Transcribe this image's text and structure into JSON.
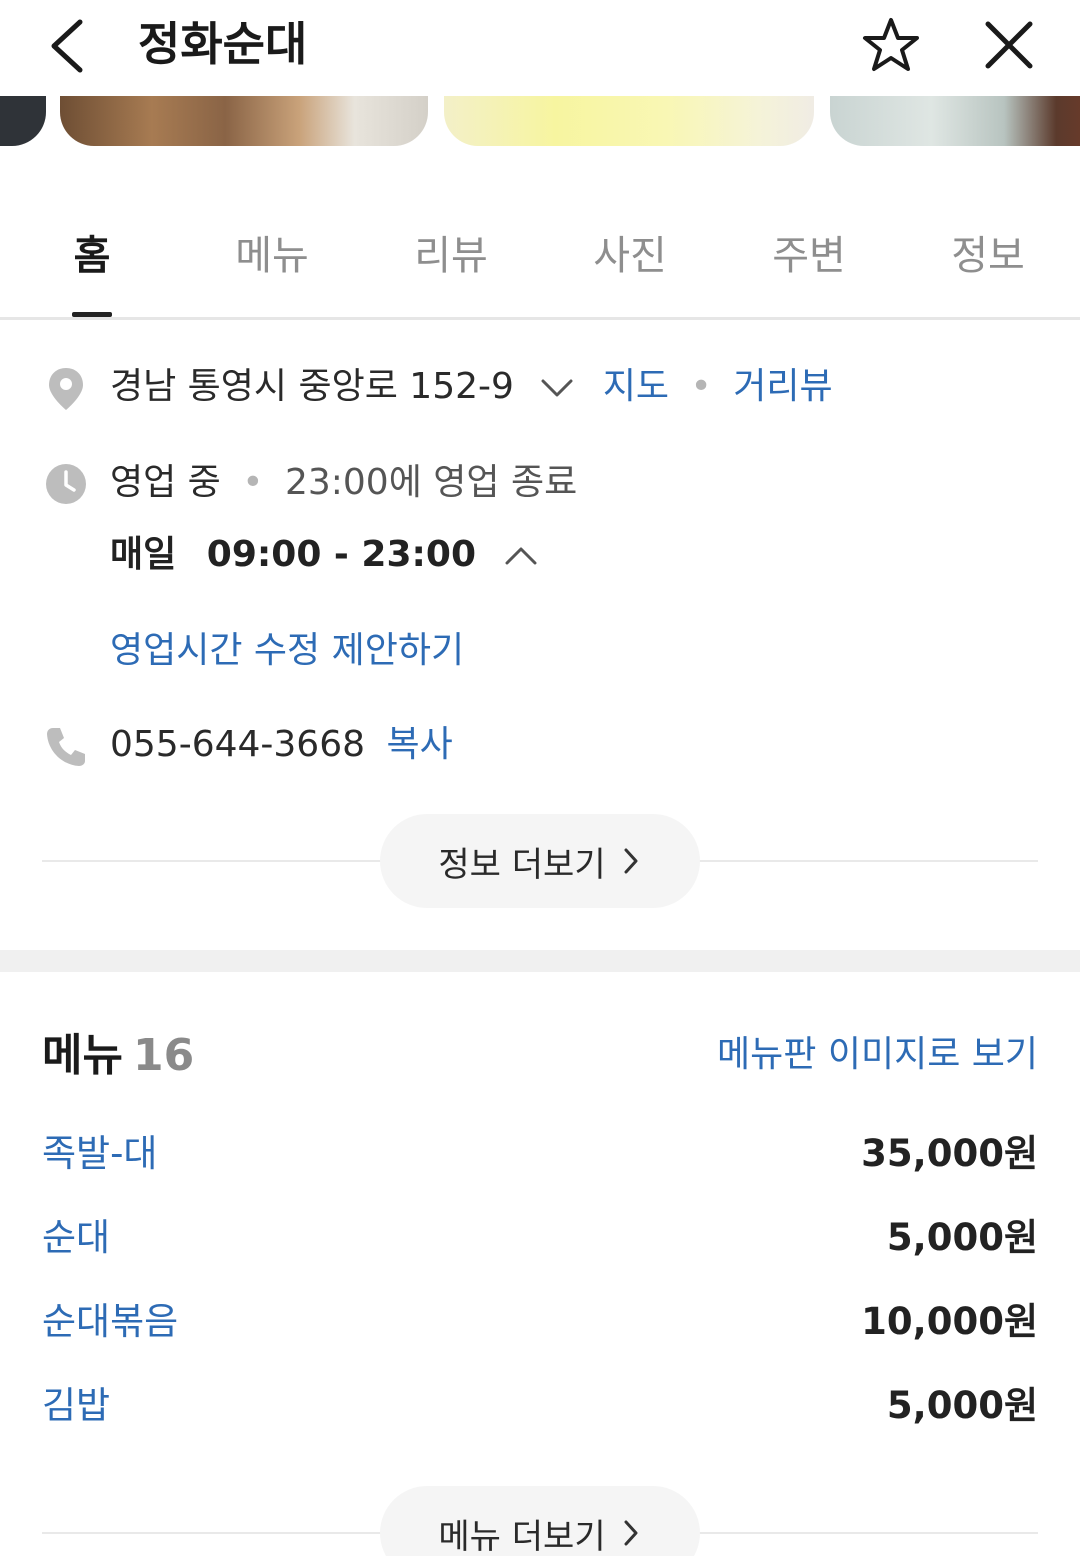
{
  "header": {
    "title": "정화순대"
  },
  "tabs": [
    {
      "label": "홈",
      "active": true
    },
    {
      "label": "메뉴",
      "active": false
    },
    {
      "label": "리뷰",
      "active": false
    },
    {
      "label": "사진",
      "active": false
    },
    {
      "label": "주변",
      "active": false
    },
    {
      "label": "정보",
      "active": false
    }
  ],
  "info": {
    "address": "경남 통영시 중앙로 152-9",
    "map_link": "지도",
    "streetview_link": "거리뷰",
    "status": "영업 중",
    "close_time": "23:00에 영업 종료",
    "hours_day": "매일",
    "hours_range": "09:00 - 23:00",
    "suggest_hours": "영업시간 수정 제안하기",
    "phone": "055-644-3668",
    "copy_label": "복사",
    "more_info": "정보 더보기"
  },
  "menu": {
    "title": "메뉴",
    "count": "16",
    "view_image": "메뉴판 이미지로 보기",
    "items": [
      {
        "name": "족발-대",
        "price": "35,000원"
      },
      {
        "name": "순대",
        "price": "5,000원"
      },
      {
        "name": "순대볶음",
        "price": "10,000원"
      },
      {
        "name": "김밥",
        "price": "5,000원"
      }
    ],
    "more_menu": "메뉴 더보기"
  },
  "colors": {
    "link": "#2d6bb5",
    "icon_gray": "#bdbdbd"
  }
}
